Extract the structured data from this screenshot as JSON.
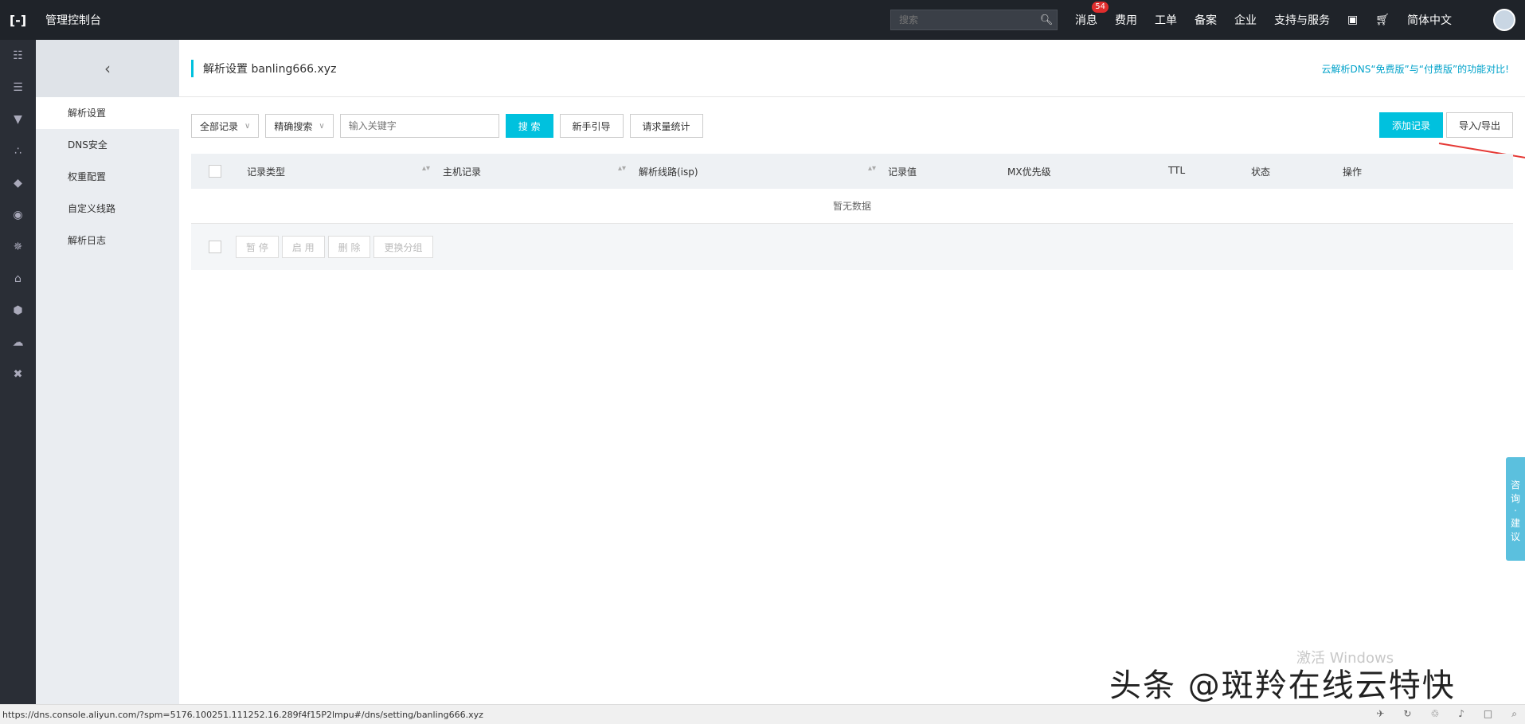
{
  "topbar": {
    "logo": "[-]",
    "title": "管理控制台",
    "search_placeholder": "搜索",
    "nav": {
      "messages": "消息",
      "messages_badge": "54",
      "billing": "费用",
      "tickets": "工单",
      "icp": "备案",
      "enterprise": "企业",
      "support": "支持与服务",
      "language": "简体中文"
    }
  },
  "sidebar": {
    "items": [
      "解析设置",
      "DNS安全",
      "权重配置",
      "自定义线路",
      "解析日志"
    ]
  },
  "page": {
    "title": "解析设置 banling666.xyz",
    "compare_link": "云解析DNS“免费版”与“付费版”的功能对比!"
  },
  "toolbar": {
    "record_filter": "全部记录",
    "search_mode": "精确搜索",
    "keyword_placeholder": "输入关键字",
    "search_btn": "搜 索",
    "guide_btn": "新手引导",
    "stats_btn": "请求量统计",
    "add_record_btn": "添加记录",
    "import_export_btn": "导入/导出"
  },
  "table": {
    "columns": [
      "记录类型",
      "主机记录",
      "解析线路(isp)",
      "记录值",
      "MX优先级",
      "TTL",
      "状态",
      "操作"
    ],
    "empty_text": "暂无数据",
    "batch_buttons": [
      "暂 停",
      "启 用",
      "删 除",
      "更换分组"
    ]
  },
  "float_tab": [
    "咨",
    "询",
    "·",
    "建",
    "议"
  ],
  "watermark": {
    "windows": "激活 Windows",
    "brand": "头条 @斑羚在线云特快"
  },
  "statusbar": {
    "url": "https://dns.console.aliyun.com/?spm=5176.100251.111252.16.289f4f15P2lmpu#/dns/setting/banling666.xyz"
  }
}
